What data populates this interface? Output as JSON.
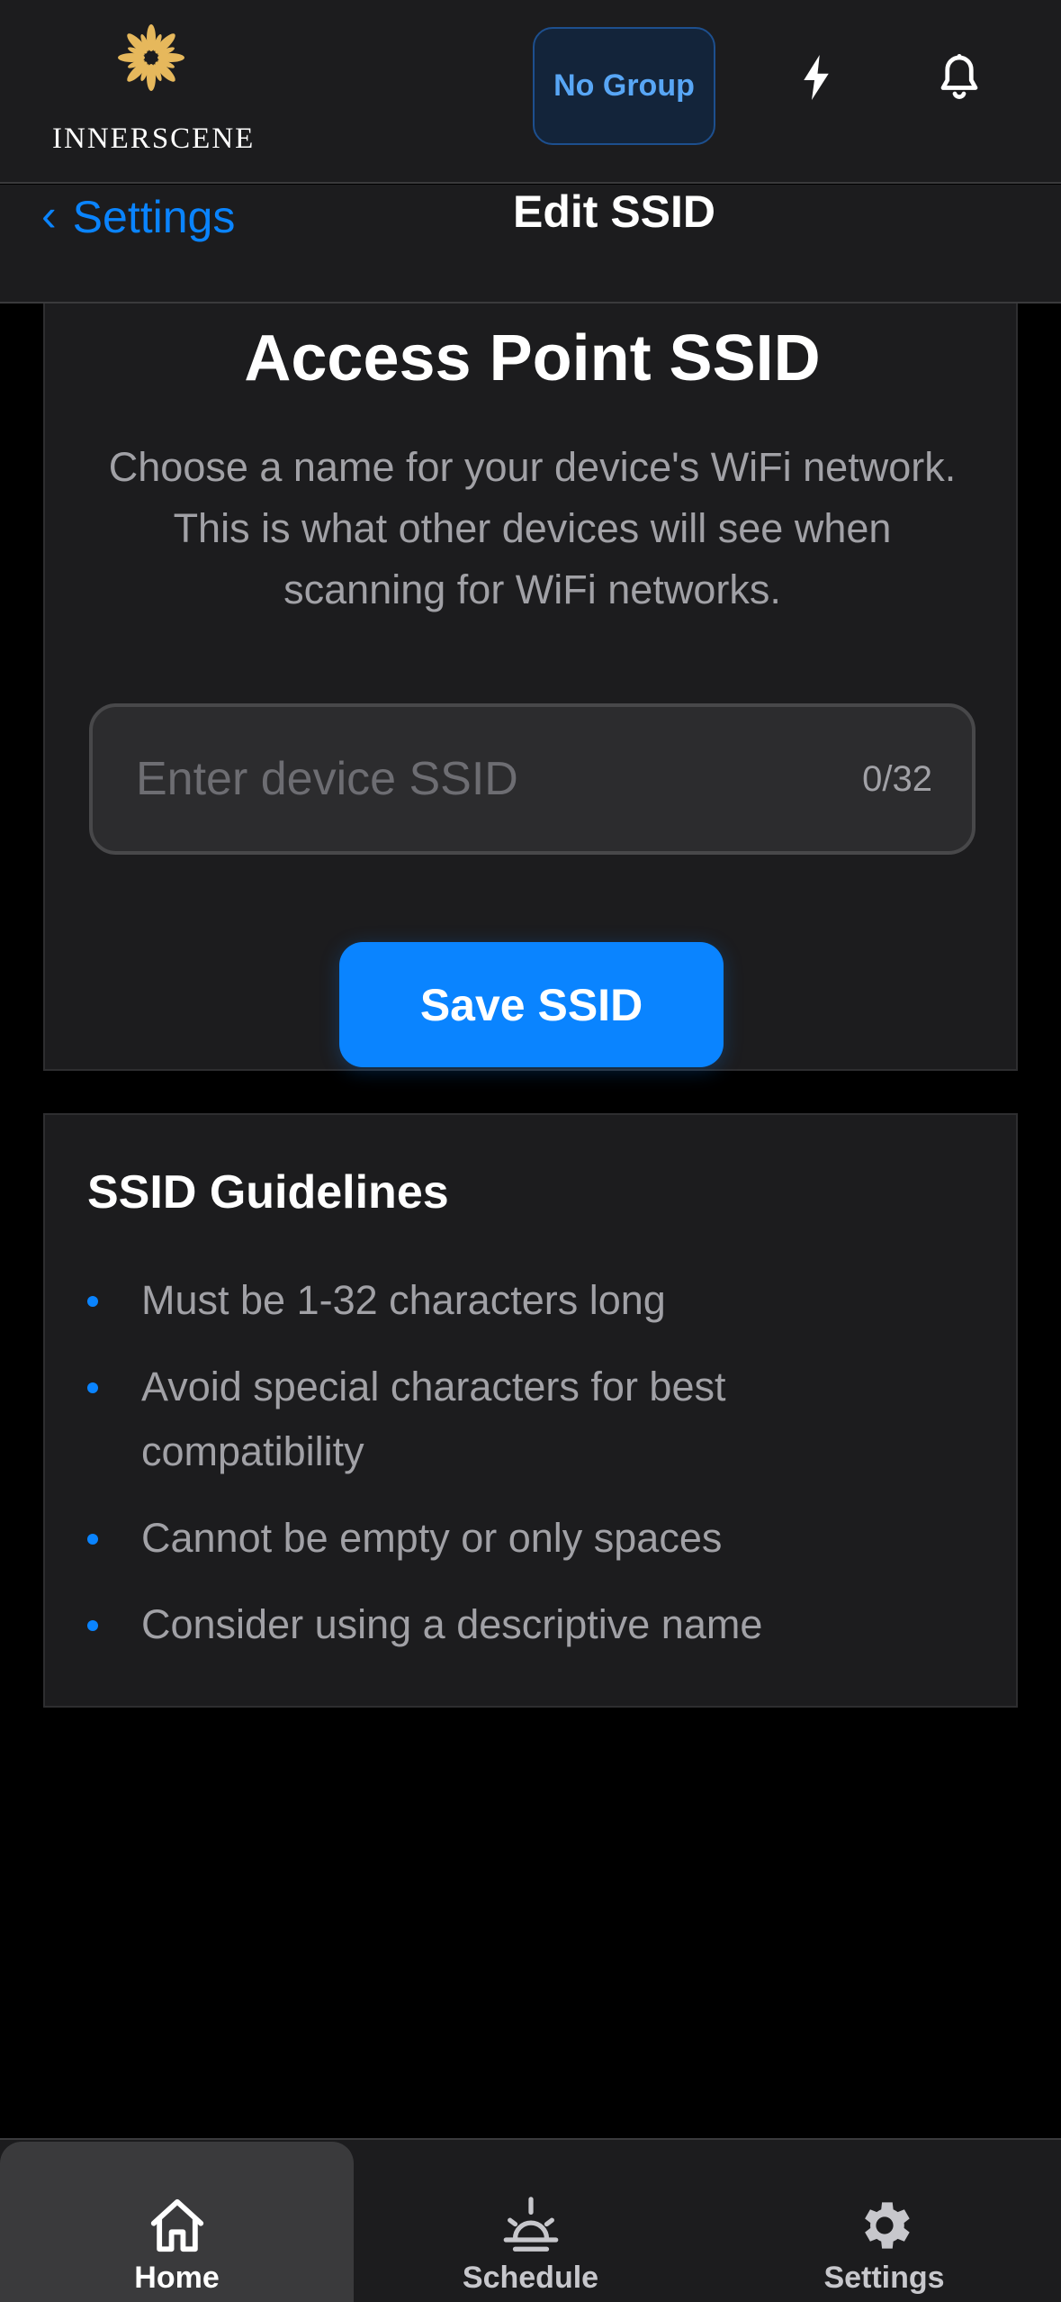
{
  "header": {
    "brand": "INNERSCENE",
    "group_button": "No Group",
    "icons": [
      "lightning-icon",
      "bell-icon"
    ]
  },
  "nav": {
    "back_label": "Settings",
    "title": "Edit SSID"
  },
  "ssid_card": {
    "title": "Access Point SSID",
    "description": "Choose a name for your device's WiFi network. This is what other devices will see when scanning for WiFi networks.",
    "input_value": "",
    "input_placeholder": "Enter device SSID",
    "counter": "0/32",
    "save_label": "Save SSID"
  },
  "guidelines": {
    "title": "SSID Guidelines",
    "items": [
      "Must be 1-32 characters long",
      "Avoid special characters for best compatibility",
      "Cannot be empty or only spaces",
      "Consider using a descriptive name"
    ]
  },
  "tabbar": {
    "tabs": [
      {
        "label": "Home",
        "icon": "home-icon",
        "active": true
      },
      {
        "label": "Schedule",
        "icon": "sunrise-icon",
        "active": false
      },
      {
        "label": "Settings",
        "icon": "gear-icon",
        "active": false
      }
    ]
  },
  "colors": {
    "accent": "#0a84ff",
    "background": "#000000",
    "card": "#1c1c1e",
    "logo_gold": "#e6b85c"
  }
}
